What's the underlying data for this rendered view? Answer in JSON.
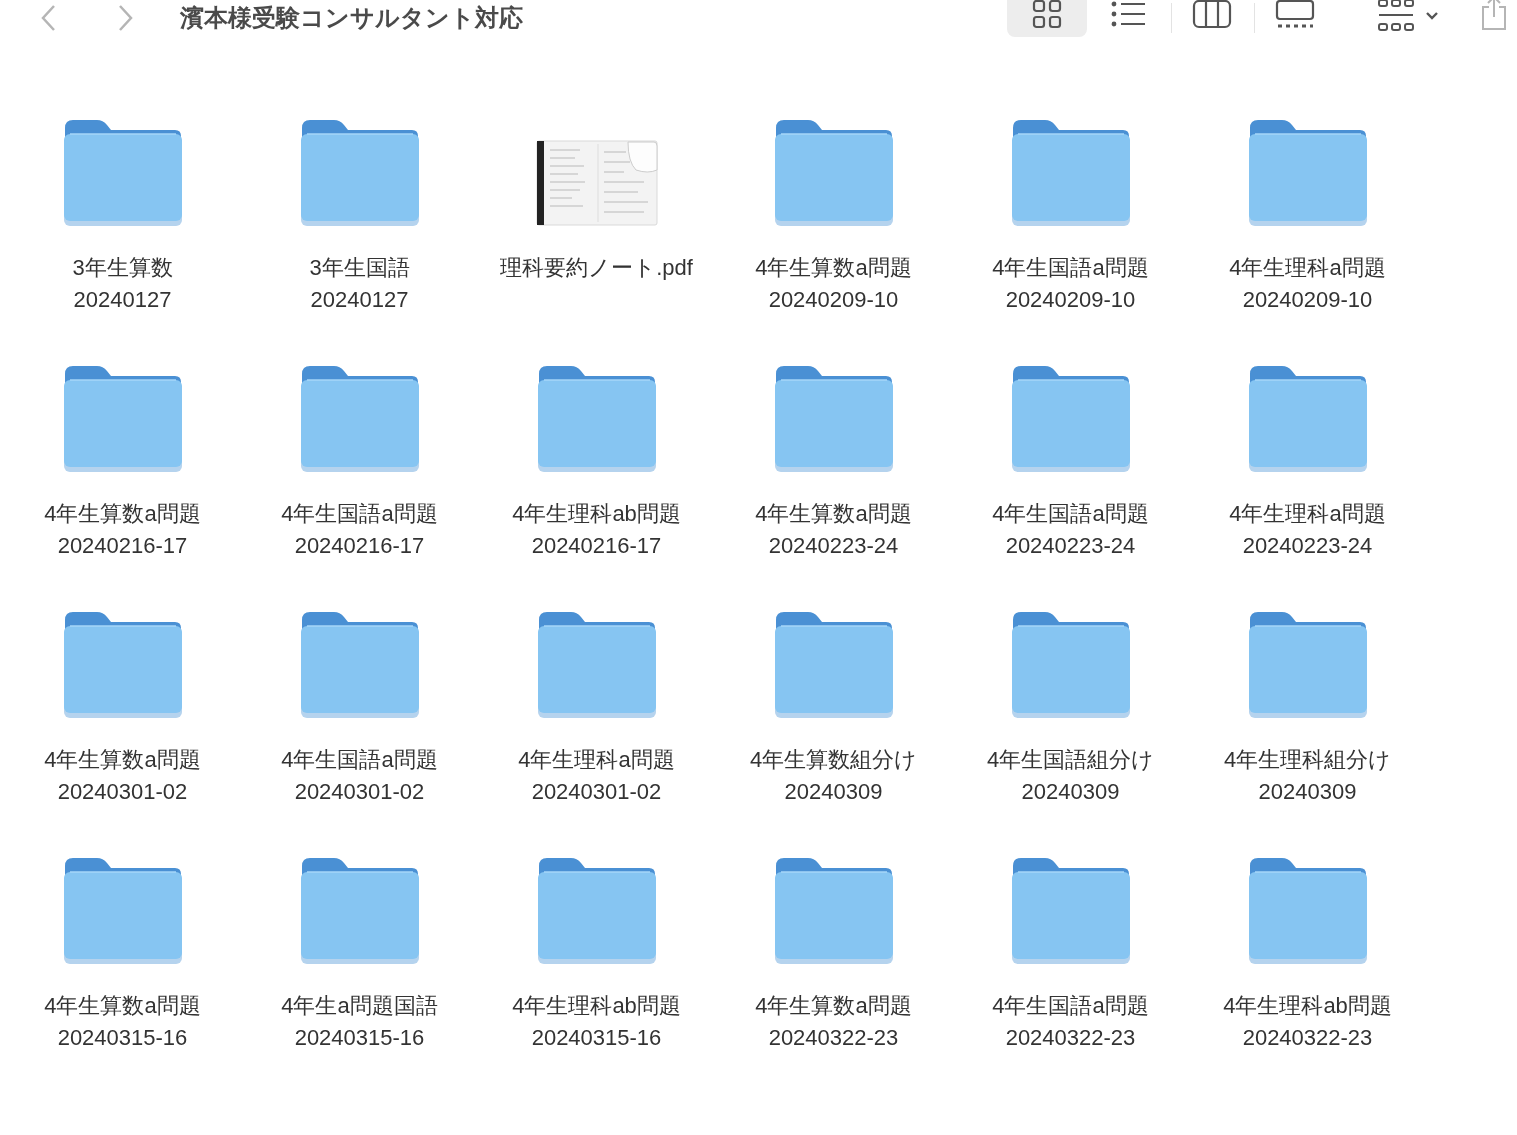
{
  "toolbar": {
    "title": "濱本様受験コンサルタント対応",
    "views": [
      {
        "kind": "icon",
        "selected": true
      },
      {
        "kind": "list",
        "selected": false
      },
      {
        "kind": "column",
        "selected": false
      },
      {
        "kind": "gallery",
        "selected": false
      }
    ]
  },
  "items": [
    {
      "kind": "folder",
      "lines": [
        "3年生算数",
        "20240127"
      ]
    },
    {
      "kind": "folder",
      "lines": [
        "3年生国語",
        "20240127"
      ]
    },
    {
      "kind": "pdf",
      "lines": [
        "理科要約ノート.pdf"
      ]
    },
    {
      "kind": "folder",
      "lines": [
        "4年生算数a問題",
        "20240209-10"
      ]
    },
    {
      "kind": "folder",
      "lines": [
        "4年生国語a問題",
        "20240209-10"
      ]
    },
    {
      "kind": "folder",
      "lines": [
        "4年生理科a問題",
        "20240209-10"
      ]
    },
    {
      "kind": "folder",
      "lines": [
        "4年生算数a問題",
        "20240216-17"
      ]
    },
    {
      "kind": "folder",
      "lines": [
        "4年生国語a問題",
        "20240216-17"
      ]
    },
    {
      "kind": "folder",
      "lines": [
        "4年生理科ab問題",
        "20240216-17"
      ]
    },
    {
      "kind": "folder",
      "lines": [
        "4年生算数a問題",
        "20240223-24"
      ]
    },
    {
      "kind": "folder",
      "lines": [
        "4年生国語a問題",
        "20240223-24"
      ]
    },
    {
      "kind": "folder",
      "lines": [
        "4年生理科a問題",
        "20240223-24"
      ]
    },
    {
      "kind": "folder",
      "lines": [
        "4年生算数a問題",
        "20240301-02"
      ]
    },
    {
      "kind": "folder",
      "lines": [
        "4年生国語a問題",
        "20240301-02"
      ]
    },
    {
      "kind": "folder",
      "lines": [
        "4年生理科a問題",
        "20240301-02"
      ]
    },
    {
      "kind": "folder",
      "lines": [
        "4年生算数組分け",
        "20240309"
      ]
    },
    {
      "kind": "folder",
      "lines": [
        "4年生国語組分け",
        "20240309"
      ]
    },
    {
      "kind": "folder",
      "lines": [
        "4年生理科組分け",
        "20240309"
      ]
    },
    {
      "kind": "folder",
      "lines": [
        "4年生算数a問題",
        "20240315-16"
      ]
    },
    {
      "kind": "folder",
      "lines": [
        "4年生a問題国語",
        "20240315-16"
      ]
    },
    {
      "kind": "folder",
      "lines": [
        "4年生理科ab問題",
        "20240315-16"
      ]
    },
    {
      "kind": "folder",
      "lines": [
        "4年生算数a問題",
        "20240322-23"
      ]
    },
    {
      "kind": "folder",
      "lines": [
        "4年生国語a問題",
        "20240322-23"
      ]
    },
    {
      "kind": "folder",
      "lines": [
        "4年生理科ab問題",
        "20240322-23"
      ]
    }
  ]
}
